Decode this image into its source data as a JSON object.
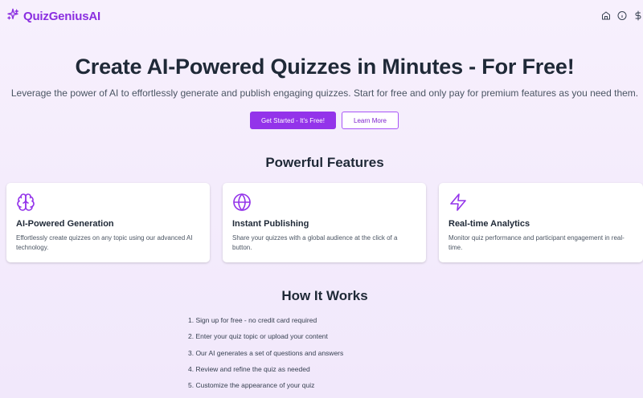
{
  "header": {
    "brand_name": "QuizGeniusAI",
    "icons": [
      "sparkle-icon",
      "home-icon",
      "info-icon",
      "dollar-icon"
    ]
  },
  "hero": {
    "title": "Create AI-Powered Quizzes in Minutes - For Free!",
    "subtitle": "Leverage the power of AI to effortlessly generate and publish engaging quizzes. Start for free and only pay for premium features as you need them.",
    "primary_button": "Get Started - It's Free!",
    "secondary_button": "Learn More"
  },
  "features": {
    "title": "Powerful Features",
    "items": [
      {
        "icon": "brain-icon",
        "title": "AI-Powered Generation",
        "description": "Effortlessly create quizzes on any topic using our advanced AI technology."
      },
      {
        "icon": "globe-icon",
        "title": "Instant Publishing",
        "description": "Share your quizzes with a global audience at the click of a button."
      },
      {
        "icon": "lightning-icon",
        "title": "Real-time Analytics",
        "description": "Monitor quiz performance and participant engagement in real-time."
      }
    ]
  },
  "how_it_works": {
    "title": "How It Works",
    "steps": [
      "1. Sign up for free - no credit card required",
      "2. Enter your quiz topic or upload your content",
      "3. Our AI generates a set of questions and answers",
      "4. Review and refine the quiz as needed",
      "5. Customize the appearance of your quiz"
    ]
  },
  "colors": {
    "accent": "#9333ea",
    "brand": "#8b2fe0",
    "background": "#f4ecfc"
  }
}
